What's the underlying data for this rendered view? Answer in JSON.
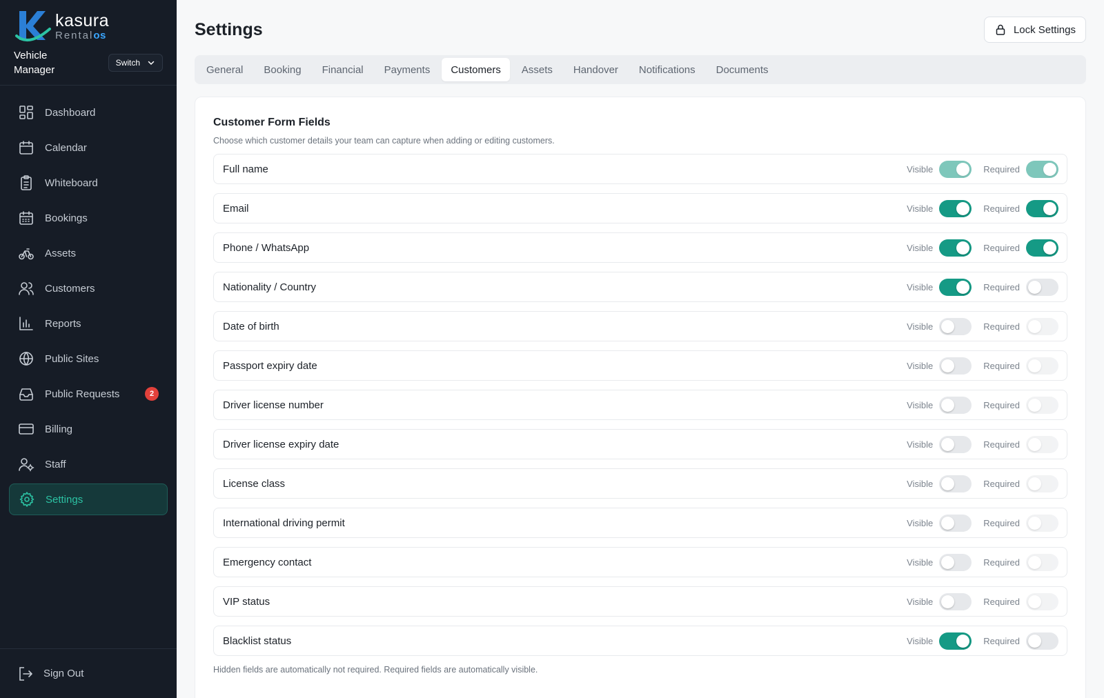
{
  "brand": {
    "name": "kasura",
    "sub": "Rental",
    "sub_accent": "os",
    "manager_title": "Vehicle Manager",
    "switch_label": "Switch"
  },
  "nav": [
    {
      "label": "Dashboard",
      "icon": "dashboard-icon"
    },
    {
      "label": "Calendar",
      "icon": "calendar-icon"
    },
    {
      "label": "Whiteboard",
      "icon": "clipboard-icon"
    },
    {
      "label": "Bookings",
      "icon": "bookings-calendar-icon"
    },
    {
      "label": "Assets",
      "icon": "bike-icon"
    },
    {
      "label": "Customers",
      "icon": "users-icon"
    },
    {
      "label": "Reports",
      "icon": "bar-chart-icon"
    },
    {
      "label": "Public Sites",
      "icon": "globe-icon"
    },
    {
      "label": "Public Requests",
      "icon": "inbox-icon",
      "badge": "2"
    },
    {
      "label": "Billing",
      "icon": "credit-card-icon"
    },
    {
      "label": "Staff",
      "icon": "user-gear-icon"
    },
    {
      "label": "Settings",
      "icon": "gear-icon",
      "active": true
    }
  ],
  "signout_label": "Sign Out",
  "header": {
    "title": "Settings",
    "lock_label": "Lock Settings"
  },
  "tabs": [
    {
      "label": "General"
    },
    {
      "label": "Booking"
    },
    {
      "label": "Financial"
    },
    {
      "label": "Payments"
    },
    {
      "label": "Customers",
      "active": true
    },
    {
      "label": "Assets"
    },
    {
      "label": "Handover"
    },
    {
      "label": "Notifications"
    },
    {
      "label": "Documents"
    }
  ],
  "card": {
    "title": "Customer Form Fields",
    "subtitle": "Choose which customer details your team can capture when adding or editing customers.",
    "visible_label": "Visible",
    "required_label": "Required",
    "note": "Hidden fields are automatically not required. Required fields are automatically visible."
  },
  "fields": [
    {
      "label": "Full name",
      "visible": true,
      "required": true,
      "locked": true
    },
    {
      "label": "Email",
      "visible": true,
      "required": true
    },
    {
      "label": "Phone / WhatsApp",
      "visible": true,
      "required": true
    },
    {
      "label": "Nationality / Country",
      "visible": true,
      "required": false
    },
    {
      "label": "Date of birth",
      "visible": false,
      "required": false
    },
    {
      "label": "Passport expiry date",
      "visible": false,
      "required": false
    },
    {
      "label": "Driver license number",
      "visible": false,
      "required": false
    },
    {
      "label": "Driver license expiry date",
      "visible": false,
      "required": false
    },
    {
      "label": "License class",
      "visible": false,
      "required": false
    },
    {
      "label": "International driving permit",
      "visible": false,
      "required": false
    },
    {
      "label": "Emergency contact",
      "visible": false,
      "required": false
    },
    {
      "label": "VIP status",
      "visible": false,
      "required": false
    },
    {
      "label": "Blacklist status",
      "visible": true,
      "required": false
    }
  ],
  "colors": {
    "sidebar_bg": "#161c26",
    "accent": "#159a85",
    "active_nav_text": "#2cc3a4",
    "badge": "#e2413b"
  }
}
